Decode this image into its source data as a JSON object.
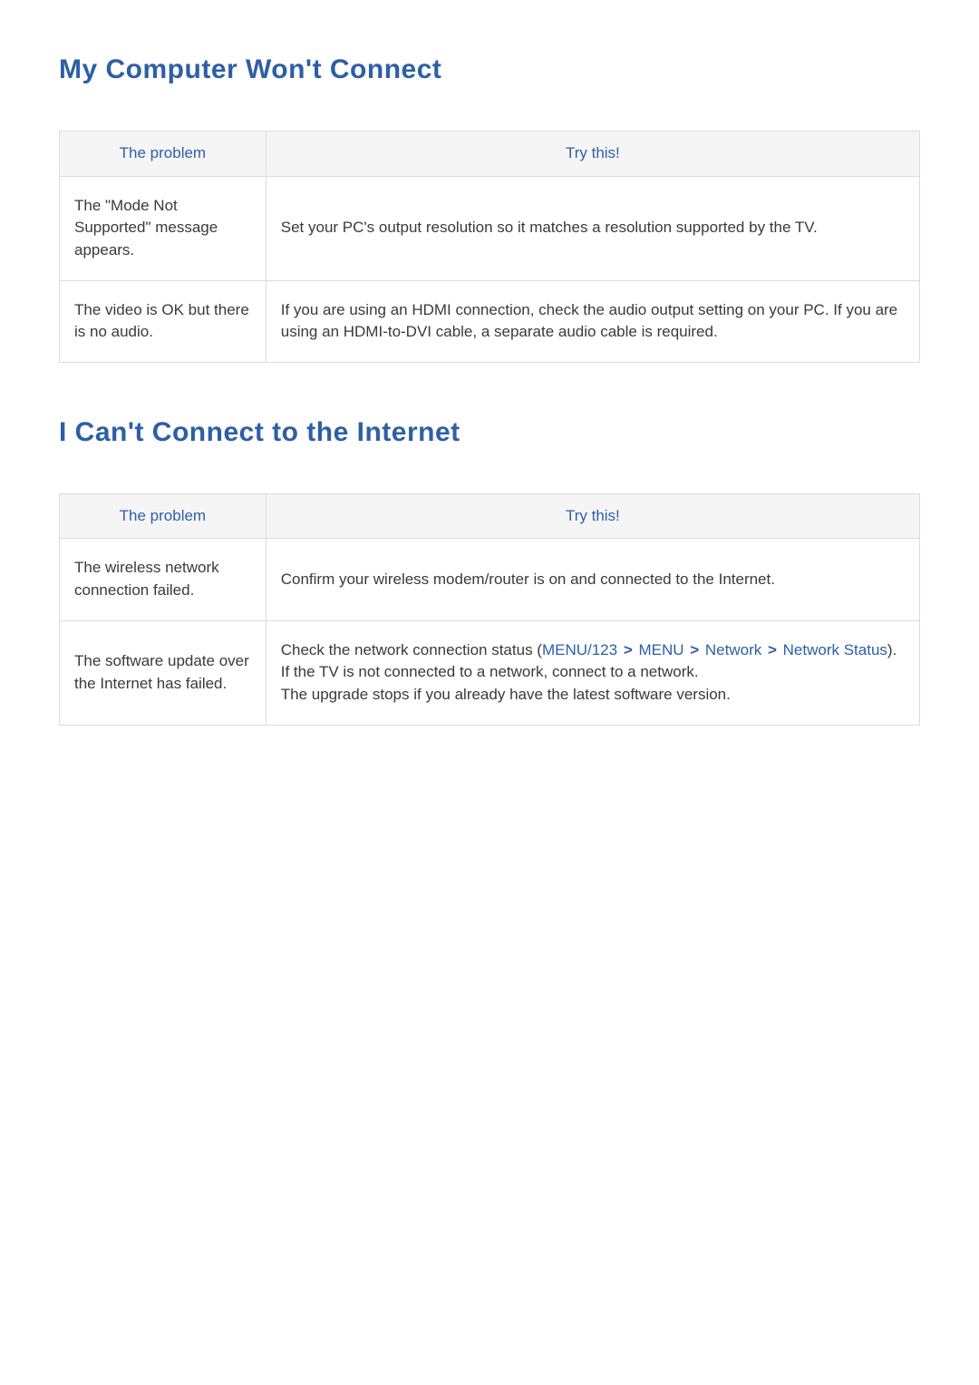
{
  "sections": [
    {
      "title": "My Computer Won't Connect",
      "headers": {
        "problem": "The problem",
        "try": "Try this!"
      },
      "rows": [
        {
          "problem": "The \"Mode Not Supported\" message appears.",
          "try": "Set your PC's output resolution so it matches a resolution supported by the TV."
        },
        {
          "problem": "The video is OK but there is no audio.",
          "try": "If you are using an HDMI connection, check the audio output setting on your PC. If you are using an HDMI-to-DVI cable, a separate audio cable is required."
        }
      ]
    },
    {
      "title": "I Can't Connect to the Internet",
      "headers": {
        "problem": "The problem",
        "try": "Try this!"
      },
      "rows": [
        {
          "problem": "The wireless network connection failed.",
          "try": "Confirm your wireless modem/router is on and connected to the Internet."
        },
        {
          "problem": "The software update over the Internet has failed.",
          "try_prefix": "Check the network connection status (",
          "try_menu": [
            "MENU/123",
            "MENU",
            "Network",
            "Network Status"
          ],
          "try_suffix_after_paren": ").",
          "try_line2": "If the TV is not connected to a network, connect to a network.",
          "try_line3": "The upgrade stops if you already have the latest software version."
        }
      ]
    }
  ]
}
